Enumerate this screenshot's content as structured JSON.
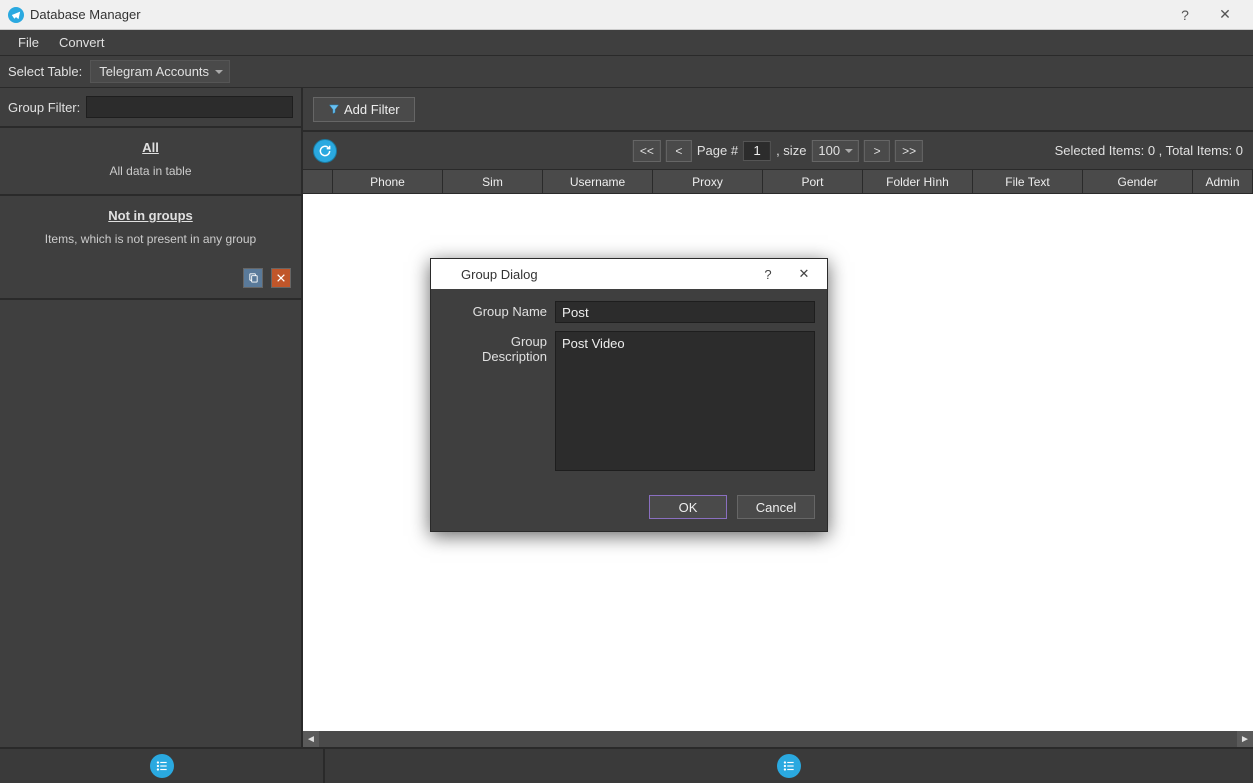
{
  "window": {
    "title": "Database Manager"
  },
  "menubar": {
    "file": "File",
    "convert": "Convert"
  },
  "toolbar": {
    "select_table_label": "Select Table:",
    "selected_table": "Telegram Accounts"
  },
  "sidebar": {
    "group_filter_label": "Group Filter:",
    "group_filter_value": "",
    "all": {
      "title": "All",
      "desc": "All data in table"
    },
    "not_in_groups": {
      "title": "Not in groups",
      "desc": "Items, which is not present in any group"
    }
  },
  "content": {
    "add_filter_label": "Add Filter",
    "pager": {
      "first": "<<",
      "prev": "<",
      "next": ">",
      "last": ">>",
      "page_label": "Page #",
      "page_value": "1",
      "size_label": ", size",
      "size_value": "100"
    },
    "status": {
      "selected_label": "Selected Items:",
      "selected_value": "0",
      "total_label": ", Total Items:",
      "total_value": "0"
    },
    "columns": [
      {
        "label": "",
        "w": 30
      },
      {
        "label": "Phone",
        "w": 110
      },
      {
        "label": "Sim",
        "w": 100
      },
      {
        "label": "Username",
        "w": 110
      },
      {
        "label": "Proxy",
        "w": 110
      },
      {
        "label": "Port",
        "w": 100
      },
      {
        "label": "Folder Hình",
        "w": 110
      },
      {
        "label": "File Text",
        "w": 110
      },
      {
        "label": "Gender",
        "w": 110
      },
      {
        "label": "Admin",
        "w": 60
      }
    ]
  },
  "dialog": {
    "title": "Group Dialog",
    "group_name_label": "Group Name",
    "group_name_value": "Post",
    "group_desc_label": "Group Description",
    "group_desc_value": "Post Video",
    "ok": "OK",
    "cancel": "Cancel"
  }
}
